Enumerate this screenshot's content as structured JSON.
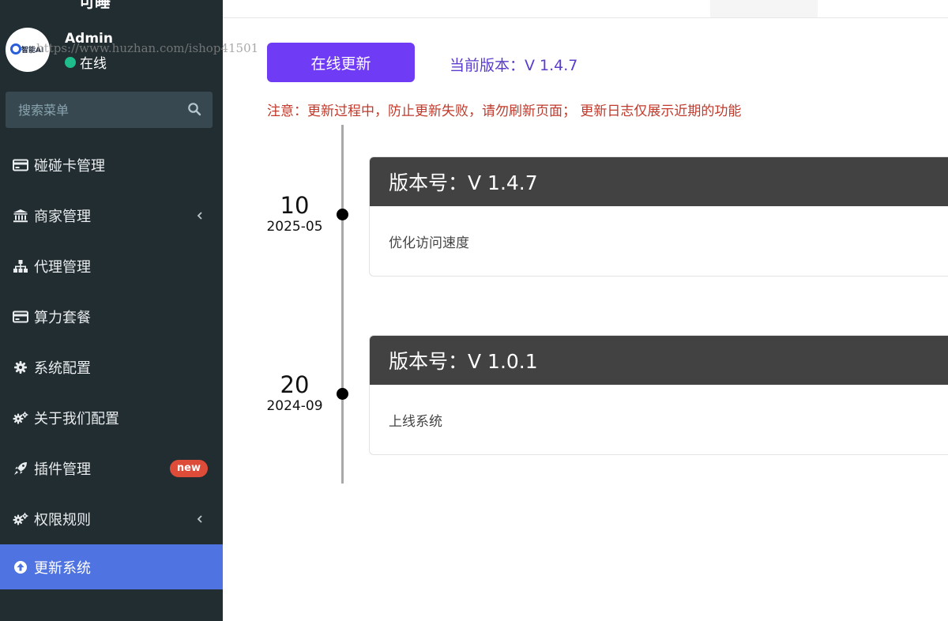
{
  "sidebar": {
    "logo_text": "可睡",
    "user": {
      "name": "Admin",
      "status": "在线"
    },
    "search": {
      "placeholder": "搜索菜单"
    },
    "items": [
      {
        "label": "碰碰卡管理",
        "icon": "credit-card-icon"
      },
      {
        "label": "商家管理",
        "icon": "bank-icon",
        "has_submenu": true
      },
      {
        "label": "代理管理",
        "icon": "sitemap-icon"
      },
      {
        "label": "算力套餐",
        "icon": "credit-card-icon"
      },
      {
        "label": "系统配置",
        "icon": "gear-icon"
      },
      {
        "label": "关于我们配置",
        "icon": "gears-icon"
      },
      {
        "label": "插件管理",
        "icon": "rocket-icon",
        "badge": "new"
      },
      {
        "label": "权限规则",
        "icon": "gears-icon",
        "has_submenu": true
      },
      {
        "label": "更新系统",
        "icon": "arrow-circle-up-icon",
        "active": true
      }
    ]
  },
  "main": {
    "update_button": "在线更新",
    "current_version": "当前版本：V 1.4.7",
    "notice": "注意：更新过程中，防止更新失败，请勿刷新页面；  更新日志仅展示近期的功能",
    "timeline": [
      {
        "day": "10",
        "month": "2025-05",
        "title": "版本号：V 1.4.7",
        "content": "优化访问速度"
      },
      {
        "day": "20",
        "month": "2024-09",
        "title": "版本号：V 1.0.1",
        "content": "上线系统"
      }
    ]
  },
  "watermark": "https://www.huzhan.com/ishop41501",
  "colors": {
    "sidebar_bg": "#222d32",
    "active_item": "#4f73e0",
    "update_button": "#6f3bf4",
    "version_text": "#5b3ccc",
    "notice_text": "#c0392b",
    "card_header": "#424242",
    "status_online": "#1ebd8b",
    "badge_new": "#dd4b39"
  }
}
